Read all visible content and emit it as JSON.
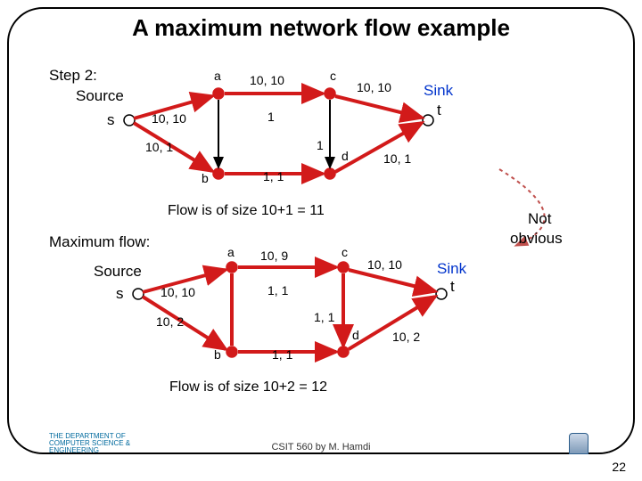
{
  "title": "A maximum network flow example",
  "step_label": "Step 2:",
  "maxflow_label": "Maximum flow:",
  "source_label": "Source",
  "sink_label": "Sink",
  "not_obvious": "Not obvious",
  "node_labels": {
    "s": "s",
    "a": "a",
    "b": "b",
    "c": "c",
    "d": "d",
    "t": "t"
  },
  "flow1": {
    "sa": "10, 10",
    "sb": "10, 1",
    "ac": "10, 10",
    "ab": "1",
    "bd": "1, 1",
    "cd": "1",
    "ct": "10, 10",
    "dt": "10, 1",
    "text": "Flow is of size 10+1 = 11"
  },
  "flow2": {
    "sa": "10, 10",
    "sb": "10, 2",
    "ac": "10, 9",
    "ab": "1, 1",
    "bd": "1, 1",
    "cd": "1, 1",
    "ct": "10, 10",
    "dt": "10, 2",
    "text": "Flow is of size 10+2 = 12"
  },
  "footer": "CSIT 560 by M. Hamdi",
  "page": "22",
  "logo_left": "THE DEPARTMENT OF\nCOMPUTER SCIENCE &\nENGINEERING"
}
